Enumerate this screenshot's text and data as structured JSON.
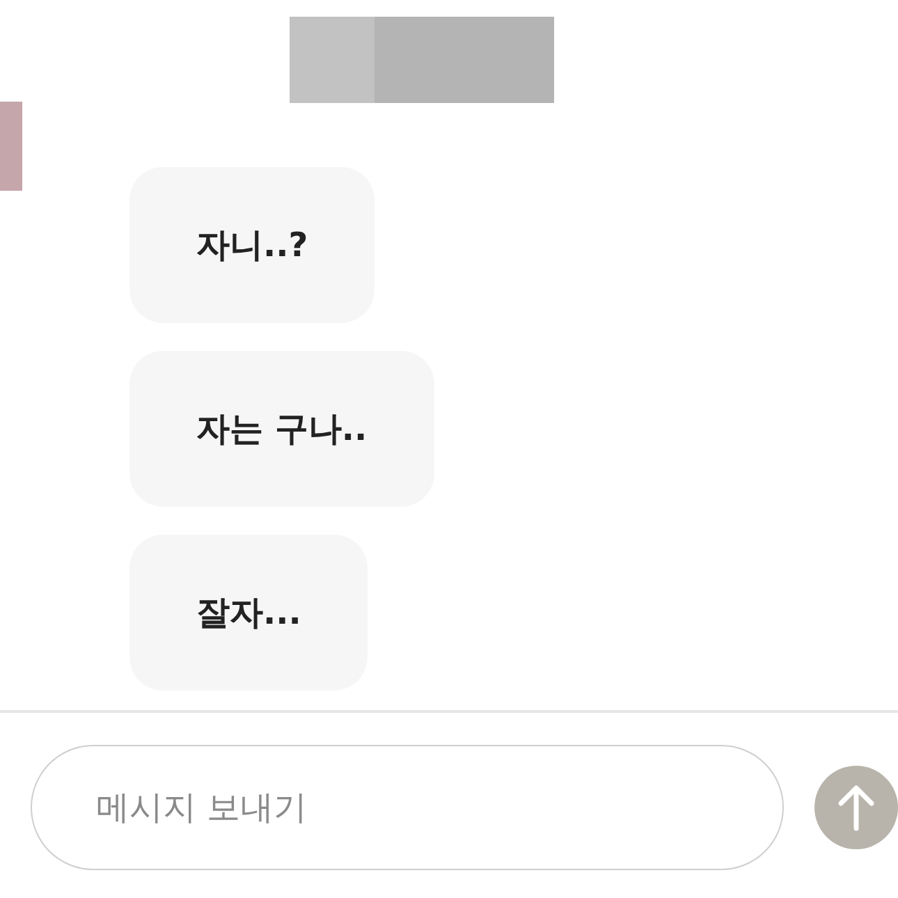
{
  "messages": [
    {
      "text": "자니..?"
    },
    {
      "text": "자는 구나.."
    },
    {
      "text": "잘자..."
    }
  ],
  "composer": {
    "placeholder": "메시지 보내기"
  }
}
